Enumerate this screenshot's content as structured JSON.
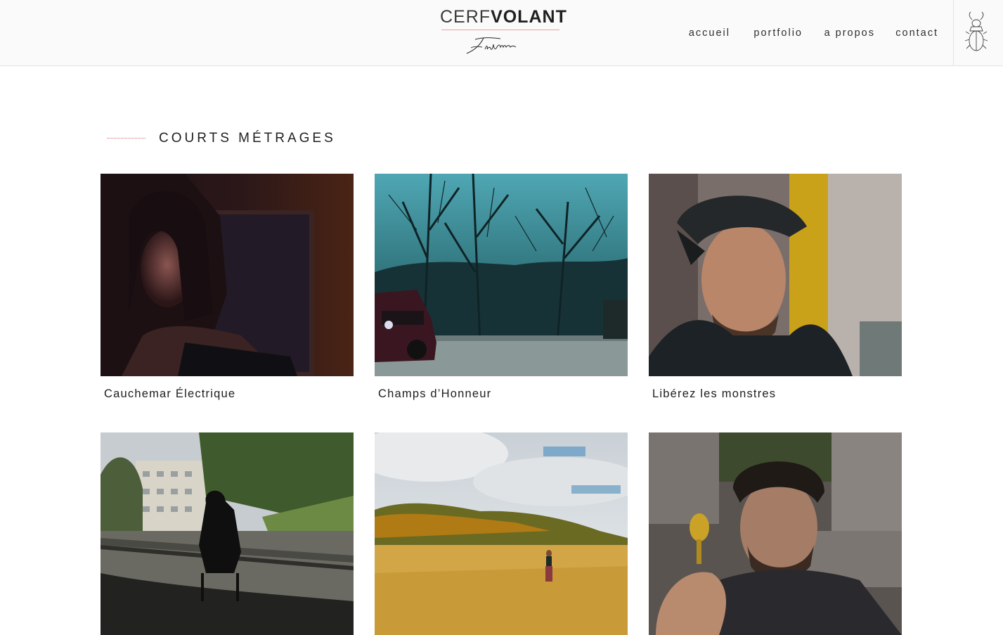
{
  "header": {
    "logo": {
      "word_light": "CERF",
      "word_bold": "VOLANT",
      "script_text": "films"
    },
    "nav": [
      {
        "label": "accueil"
      },
      {
        "label": "portfolio"
      },
      {
        "label": "a propos"
      },
      {
        "label": "contact"
      }
    ],
    "menu_icon": "stag-beetle-icon"
  },
  "section": {
    "title": "COURTS MÉTRAGES"
  },
  "films": [
    {
      "title": "Cauchemar Électrique"
    },
    {
      "title": "Champs d’Honneur"
    },
    {
      "title": "Libérez les monstres"
    },
    {
      "title": ""
    },
    {
      "title": ""
    },
    {
      "title": ""
    }
  ],
  "colors": {
    "accent": "#d8636d",
    "text": "#1d1d1d",
    "header_bg": "#fafafa"
  }
}
